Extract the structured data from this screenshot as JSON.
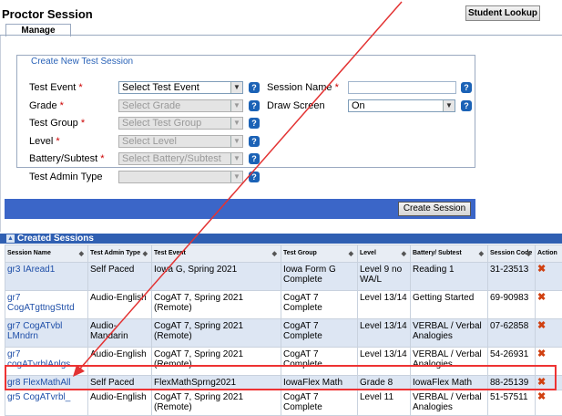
{
  "header": {
    "title": "Proctor Session",
    "student_lookup": "Student Lookup"
  },
  "tabs": [
    {
      "label": "Manage"
    }
  ],
  "form": {
    "legend": "Create New Test Session",
    "fields": {
      "test_event": {
        "label": "Test Event",
        "value": "Select Test Event"
      },
      "grade": {
        "label": "Grade",
        "value": "Select Grade"
      },
      "test_group": {
        "label": "Test Group",
        "value": "Select Test Group"
      },
      "level": {
        "label": "Level",
        "value": "Select Level"
      },
      "battery": {
        "label": "Battery/Subtest",
        "value": "Select Battery/Subtest"
      },
      "admin_type": {
        "label": "Test Admin Type",
        "value": ""
      },
      "session_name": {
        "label": "Session Name",
        "value": ""
      },
      "draw_screen": {
        "label": "Draw Screen",
        "value": "On"
      }
    },
    "required_mark": "*",
    "help_glyph": "?",
    "create_button": "Create Session"
  },
  "sessions": {
    "title": "Created Sessions",
    "toggle_glyph": "▲",
    "columns": [
      "Session Name",
      "Test Admin Type",
      "Test Event",
      "Test Group",
      "Level",
      "Battery/ Subtest",
      "Session Code",
      "Action"
    ],
    "rows": [
      {
        "name": "gr3 IAread1",
        "admin": "Self Paced",
        "event": "Iowa G, Spring 2021",
        "group": "Iowa Form G Complete",
        "level": "Level 9 no WA/L",
        "battery": "Reading 1",
        "code": "31-23513"
      },
      {
        "name": "gr7 CogATgttngStrtd",
        "admin": "Audio-English",
        "event": "CogAT 7, Spring 2021 (Remote)",
        "group": "CogAT 7 Complete",
        "level": "Level 13/14",
        "battery": "Getting Started",
        "code": "69-90983"
      },
      {
        "name": "gr7 CogATvbl LMndrn",
        "admin": "Audio-Mandarin",
        "event": "CogAT 7, Spring 2021 (Remote)",
        "group": "CogAT 7 Complete",
        "level": "Level 13/14",
        "battery": "VERBAL / Verbal Analogies",
        "code": "07-62858"
      },
      {
        "name": "gr7 cogATvrblAnlgs",
        "admin": "Audio-English",
        "event": "CogAT 7, Spring 2021 (Remote)",
        "group": "CogAT 7 Complete",
        "level": "Level 13/14",
        "battery": "VERBAL / Verbal Analogies",
        "code": "54-26931"
      },
      {
        "name": "gr8 FlexMathAll",
        "admin": "Self Paced",
        "event": "FlexMathSprng2021",
        "group": "IowaFlex Math",
        "level": "Grade 8",
        "battery": "IowaFlex Math",
        "code": "88-25139"
      },
      {
        "name": "gr5 CogATvrbl_",
        "admin": "Audio-English",
        "event": "CogAT 7, Spring 2021 (Remote)",
        "group": "CogAT 7 Complete",
        "level": "Level 11",
        "battery": "VERBAL / Verbal Analogies",
        "code": "51-57511"
      }
    ],
    "delete_glyph": "✖",
    "sort_glyph": "◆"
  },
  "colors": {
    "accent_bar": "#3b66c8",
    "section_header": "#2f5fb2",
    "annotation": "#e33333"
  }
}
